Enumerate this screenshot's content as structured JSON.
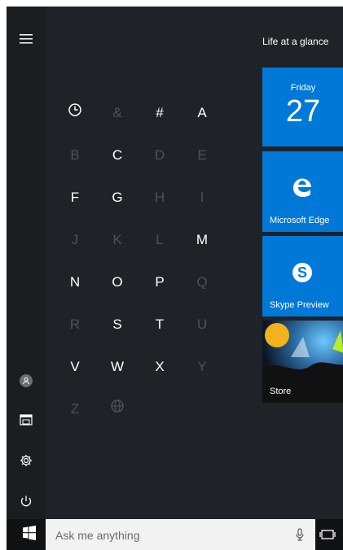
{
  "start": {
    "letters": [
      [
        "clock",
        "&",
        "#",
        "A"
      ],
      [
        "B",
        "C",
        "D",
        "E"
      ],
      [
        "F",
        "G",
        "H",
        "I"
      ],
      [
        "J",
        "K",
        "L",
        "M"
      ],
      [
        "N",
        "O",
        "P",
        "Q"
      ],
      [
        "R",
        "S",
        "T",
        "U"
      ],
      [
        "V",
        "W",
        "X",
        "Y"
      ],
      [
        "Z",
        "globe"
      ]
    ],
    "disabled": [
      "&",
      "B",
      "D",
      "E",
      "H",
      "I",
      "J",
      "K",
      "L",
      "Q",
      "R",
      "U",
      "Y",
      "Z"
    ]
  },
  "tiles": {
    "header": "Life at a glance",
    "calendar": {
      "day": "Friday",
      "date": "27"
    },
    "edge": {
      "label": "Microsoft Edge"
    },
    "skype": {
      "label": "Skype Preview"
    },
    "store": {
      "label": "Store"
    }
  },
  "taskbar": {
    "search_placeholder": "Ask me anything"
  },
  "colors": {
    "accent": "#0078d7",
    "start_bg": "#1f2327",
    "rail_bg": "#1b1e21"
  },
  "icons": {
    "hamburger": "hamburger-icon",
    "user": "user-icon",
    "explorer": "file-explorer-icon",
    "settings": "gear-icon",
    "power": "power-icon",
    "clock": "clock-icon",
    "globe": "globe-icon",
    "windows": "windows-logo-icon",
    "mic": "microphone-icon",
    "taskview": "task-view-icon"
  }
}
